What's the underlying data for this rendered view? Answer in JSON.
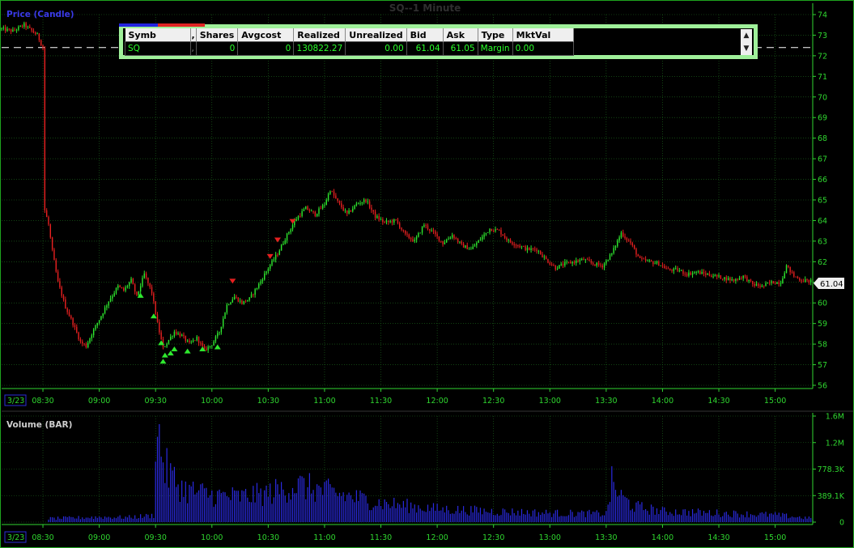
{
  "chart_title": "SQ--1 Minute",
  "price_panel_label": "Price (Candle)",
  "volume_panel_label": "Volume (BAR)",
  "date_tag": "3/23",
  "last_price_tag": "61.04",
  "colors": {
    "up": "#2ee82e",
    "down": "#e62020",
    "volume": "#2a2ae0",
    "grid": "#1e6e1e",
    "axis_text": "#2fd62f",
    "accent": "#9ff09a"
  },
  "position_table": {
    "headers": [
      "Symb",
      ",",
      "Shares",
      "Avgcost",
      "Realized",
      "Unrealized",
      "Bid",
      "Ask",
      "Type",
      "MktVal"
    ],
    "row": [
      "SQ",
      ",",
      "0",
      "0",
      "130822.27",
      "0.00",
      "61.04",
      "61.05",
      "Margin",
      "0.00"
    ],
    "scroll_up_icon": "▲",
    "scroll_down_icon": "▼"
  },
  "chart_data": [
    {
      "type": "candlestick",
      "title": "SQ--1 Minute",
      "ylabel": "Price (Candle)",
      "ylim": [
        56,
        74
      ],
      "y_ticks": [
        "56",
        "57",
        "58",
        "59",
        "60",
        "61",
        "62",
        "63",
        "64",
        "65",
        "66",
        "67",
        "68",
        "69",
        "70",
        "71",
        "72",
        "73",
        "74"
      ],
      "x_ticks": [
        "08:30",
        "09:00",
        "09:30",
        "10:00",
        "10:30",
        "11:00",
        "11:30",
        "12:00",
        "12:30",
        "13:00",
        "13:30",
        "14:00",
        "14:30",
        "15:00"
      ],
      "x_range": [
        "08:08",
        "15:20"
      ],
      "reference_line": 72.4,
      "last_price": 61.04,
      "close_path": [
        [
          "08:08",
          73.3
        ],
        [
          "08:14",
          73.2
        ],
        [
          "08:20",
          73.5
        ],
        [
          "08:27",
          73.0
        ],
        [
          "08:30",
          72.4
        ],
        [
          "08:31",
          64.5
        ],
        [
          "08:33",
          63.8
        ],
        [
          "08:35",
          62.5
        ],
        [
          "08:38",
          61.0
        ],
        [
          "08:42",
          59.8
        ],
        [
          "08:46",
          59.0
        ],
        [
          "08:50",
          58.1
        ],
        [
          "08:53",
          57.9
        ],
        [
          "08:56",
          58.5
        ],
        [
          "09:00",
          59.2
        ],
        [
          "09:05",
          60.1
        ],
        [
          "09:10",
          60.8
        ],
        [
          "09:13",
          60.6
        ],
        [
          "09:17",
          61.1
        ],
        [
          "09:20",
          60.3
        ],
        [
          "09:24",
          61.4
        ],
        [
          "09:28",
          60.5
        ],
        [
          "09:31",
          59.0
        ],
        [
          "09:34",
          57.8
        ],
        [
          "09:37",
          58.2
        ],
        [
          "09:40",
          58.6
        ],
        [
          "09:44",
          58.4
        ],
        [
          "09:48",
          58.0
        ],
        [
          "09:52",
          58.3
        ],
        [
          "09:56",
          57.7
        ],
        [
          "10:00",
          58.0
        ],
        [
          "10:04",
          58.6
        ],
        [
          "10:08",
          59.9
        ],
        [
          "10:12",
          60.3
        ],
        [
          "10:16",
          60.0
        ],
        [
          "10:20",
          60.2
        ],
        [
          "10:25",
          60.9
        ],
        [
          "10:30",
          61.7
        ],
        [
          "10:35",
          62.4
        ],
        [
          "10:40",
          63.3
        ],
        [
          "10:45",
          64.1
        ],
        [
          "10:50",
          64.6
        ],
        [
          "10:55",
          64.3
        ],
        [
          "11:00",
          64.8
        ],
        [
          "11:03",
          65.5
        ],
        [
          "11:07",
          64.9
        ],
        [
          "11:12",
          64.3
        ],
        [
          "11:17",
          64.8
        ],
        [
          "11:22",
          65.0
        ],
        [
          "11:27",
          64.2
        ],
        [
          "11:32",
          63.9
        ],
        [
          "11:38",
          64.0
        ],
        [
          "11:43",
          63.3
        ],
        [
          "11:48",
          63.0
        ],
        [
          "11:53",
          63.8
        ],
        [
          "11:58",
          63.4
        ],
        [
          "12:03",
          62.9
        ],
        [
          "12:08",
          63.3
        ],
        [
          "12:13",
          62.8
        ],
        [
          "12:18",
          62.6
        ],
        [
          "12:23",
          63.1
        ],
        [
          "12:28",
          63.6
        ],
        [
          "12:33",
          63.5
        ],
        [
          "12:38",
          63.0
        ],
        [
          "12:43",
          62.8
        ],
        [
          "12:48",
          62.6
        ],
        [
          "12:53",
          62.6
        ],
        [
          "12:58",
          62.1
        ],
        [
          "13:03",
          61.7
        ],
        [
          "13:08",
          61.9
        ],
        [
          "13:13",
          62.0
        ],
        [
          "13:18",
          62.1
        ],
        [
          "13:23",
          61.9
        ],
        [
          "13:28",
          61.8
        ],
        [
          "13:33",
          62.4
        ],
        [
          "13:38",
          63.4
        ],
        [
          "13:43",
          62.9
        ],
        [
          "13:48",
          62.1
        ],
        [
          "13:53",
          62.0
        ],
        [
          "13:58",
          61.9
        ],
        [
          "14:03",
          61.6
        ],
        [
          "14:08",
          61.6
        ],
        [
          "14:13",
          61.4
        ],
        [
          "14:18",
          61.5
        ],
        [
          "14:23",
          61.4
        ],
        [
          "14:28",
          61.3
        ],
        [
          "14:33",
          61.2
        ],
        [
          "14:38",
          61.1
        ],
        [
          "14:43",
          61.3
        ],
        [
          "14:48",
          60.9
        ],
        [
          "14:53",
          60.8
        ],
        [
          "14:58",
          61.0
        ],
        [
          "15:03",
          61.0
        ],
        [
          "15:06",
          61.8
        ],
        [
          "15:10",
          61.3
        ],
        [
          "15:14",
          61.1
        ],
        [
          "15:20",
          61.04
        ]
      ],
      "buy_markers": [
        [
          "09:22",
          60.8
        ],
        [
          "09:29",
          59.8
        ],
        [
          "09:33",
          58.5
        ],
        [
          "09:34",
          57.6
        ],
        [
          "09:35",
          57.9
        ],
        [
          "09:38",
          58.0
        ],
        [
          "09:40",
          58.2
        ],
        [
          "09:47",
          58.1
        ],
        [
          "09:55",
          58.2
        ],
        [
          "10:03",
          58.3
        ]
      ],
      "sell_markers": [
        [
          "10:11",
          60.7
        ],
        [
          "10:31",
          61.9
        ],
        [
          "10:35",
          62.7
        ],
        [
          "10:43",
          63.6
        ]
      ]
    },
    {
      "type": "bar",
      "title": "Volume (BAR)",
      "ylim": [
        0,
        1600000
      ],
      "y_ticks": [
        "0",
        "389.1K",
        "778.3K",
        "1.2M",
        "1.6M"
      ],
      "series": [
        {
          "values_by_time": [
            [
              "08:33",
              60000
            ],
            [
              "08:45",
              70000
            ],
            [
              "09:00",
              85000
            ],
            [
              "09:15",
              80000
            ],
            [
              "09:29",
              110000
            ],
            [
              "09:30",
              1550000
            ],
            [
              "09:31",
              1300000
            ],
            [
              "09:32",
              1400000
            ],
            [
              "09:35",
              900000
            ],
            [
              "09:40",
              700000
            ],
            [
              "09:45",
              550000
            ],
            [
              "10:00",
              450000
            ],
            [
              "10:15",
              420000
            ],
            [
              "10:30",
              480000
            ],
            [
              "10:45",
              620000
            ],
            [
              "11:00",
              520000
            ],
            [
              "11:10",
              450000
            ],
            [
              "11:30",
              320000
            ],
            [
              "12:00",
              220000
            ],
            [
              "12:30",
              180000
            ],
            [
              "13:00",
              150000
            ],
            [
              "13:30",
              140000
            ],
            [
              "13:33",
              650000
            ],
            [
              "13:38",
              420000
            ],
            [
              "13:45",
              260000
            ],
            [
              "14:00",
              180000
            ],
            [
              "14:30",
              150000
            ],
            [
              "15:00",
              120000
            ],
            [
              "15:20",
              60000
            ]
          ]
        }
      ]
    }
  ]
}
